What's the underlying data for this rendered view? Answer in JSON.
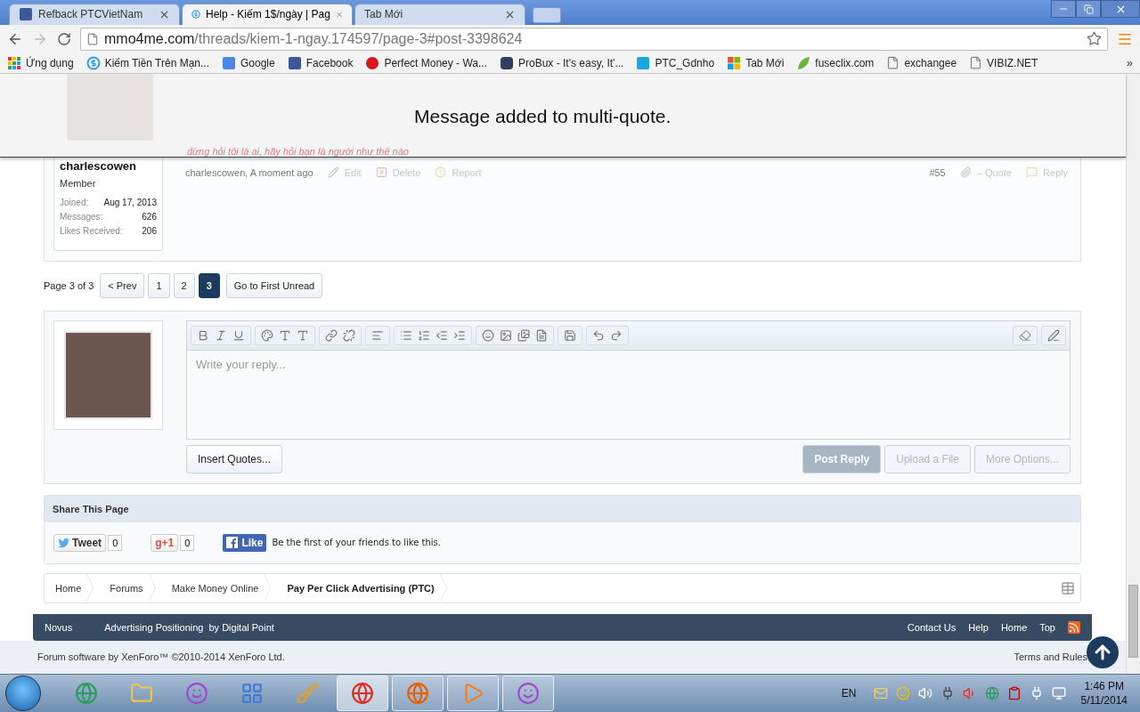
{
  "browser": {
    "tabs": [
      {
        "title": "Refback PTCVietNam",
        "kind": "square",
        "selected": false
      },
      {
        "title": "Help - Kiếm 1$/ngày | Pag",
        "kind": "dollar",
        "selected": true
      },
      {
        "title": "Tab Mới",
        "kind": "none",
        "selected": false
      }
    ],
    "address": {
      "domain": "mmo4me.com",
      "path": "/threads/kiem-1-ngay.174597/page-3#post-3398624"
    },
    "bookmarks": [
      {
        "label": "Ứng dụng",
        "kind": "apps"
      },
      {
        "label": "Kiếm Tiền Trên Mạn...",
        "kind": "dollar"
      },
      {
        "label": "Google",
        "kind": "google"
      },
      {
        "label": "Facebook",
        "kind": "square"
      },
      {
        "label": "Perfect Money - Wa...",
        "kind": "pm"
      },
      {
        "label": "ProBux - It's easy, It'...",
        "kind": "probux"
      },
      {
        "label": "PTC_Gdnho",
        "kind": "ptc"
      },
      {
        "label": "Tab Mới",
        "kind": "windows"
      },
      {
        "label": "fuseclix.com",
        "kind": "leaf"
      },
      {
        "label": "exchangee",
        "kind": "page"
      },
      {
        "label": "VIBIZ.NET",
        "kind": "page"
      }
    ],
    "more": "»"
  },
  "notice": {
    "message": "Message added to multi-quote."
  },
  "post": {
    "signature": "đừng hỏi tôi là ai, hãy hỏi bạn là người như thế nào",
    "author": "charlescowen",
    "role": "Member",
    "stats": [
      {
        "label": "Joined:",
        "value": "Aug 17, 2013"
      },
      {
        "label": "Messages:",
        "value": "626"
      },
      {
        "label": "Likes Received:",
        "value": "206"
      }
    ],
    "byline": "charlescowen, A moment ago",
    "actions": [
      {
        "label": "Edit",
        "kind": "edit"
      },
      {
        "label": "Delete",
        "kind": "delete"
      },
      {
        "label": "Report",
        "kind": "report"
      }
    ],
    "number": "#55",
    "right_actions": [
      {
        "label": "– Quote",
        "kind": "quote"
      },
      {
        "label": "Reply",
        "kind": "reply"
      }
    ]
  },
  "pagination": {
    "summary": "Page 3 of 3",
    "prev": "< Prev",
    "pages": [
      {
        "label": "1",
        "selected": false
      },
      {
        "label": "2",
        "selected": false
      },
      {
        "label": "3",
        "selected": true
      }
    ],
    "first_unread": "Go to First Unread"
  },
  "reply": {
    "placeholder": "Write your reply...",
    "insert_quotes": "Insert Quotes...",
    "buttons": [
      {
        "label": "Post Reply",
        "kind": "primary",
        "disabled": true
      },
      {
        "label": "Upload a File",
        "kind": "secondary",
        "disabled": true
      },
      {
        "label": "More Options...",
        "kind": "secondary",
        "disabled": true
      }
    ]
  },
  "share": {
    "title": "Share This Page",
    "tweet": {
      "label": "Tweet",
      "count": "0"
    },
    "gplus": {
      "label": "g+1",
      "count": "0"
    },
    "like": {
      "label": "Like",
      "text": "Be the first of your friends to like this."
    }
  },
  "breadcrumbs": [
    {
      "label": "Home",
      "current": false
    },
    {
      "label": "Forums",
      "current": false
    },
    {
      "label": "Make Money Online",
      "current": false
    },
    {
      "label": "Pay Per Click Advertising (PTC)",
      "current": true
    }
  ],
  "footer": {
    "left": [
      "Novus",
      "Advertising Positioning",
      "by Digital Point"
    ],
    "right": [
      "Contact Us",
      "Help",
      "Home",
      "Top"
    ],
    "copyright": "Forum software by XenForo™ ©2010-2014 XenForo Ltd.",
    "terms": "Terms and Rules"
  },
  "taskbar": {
    "apps": [
      {
        "kind": "globe",
        "running": false,
        "selected": false
      },
      {
        "kind": "folder",
        "running": false,
        "selected": false
      },
      {
        "kind": "chat",
        "running": false,
        "selected": false
      },
      {
        "kind": "panel",
        "running": false,
        "selected": false
      },
      {
        "kind": "paint",
        "running": false,
        "selected": false
      },
      {
        "kind": "chrome",
        "running": true,
        "selected": true
      },
      {
        "kind": "firefox",
        "running": true,
        "selected": false
      },
      {
        "kind": "media",
        "running": true,
        "selected": false
      },
      {
        "kind": "chat",
        "running": true,
        "selected": false
      }
    ],
    "language": "EN",
    "time": "1:46 PM",
    "date": "5/11/2014"
  }
}
